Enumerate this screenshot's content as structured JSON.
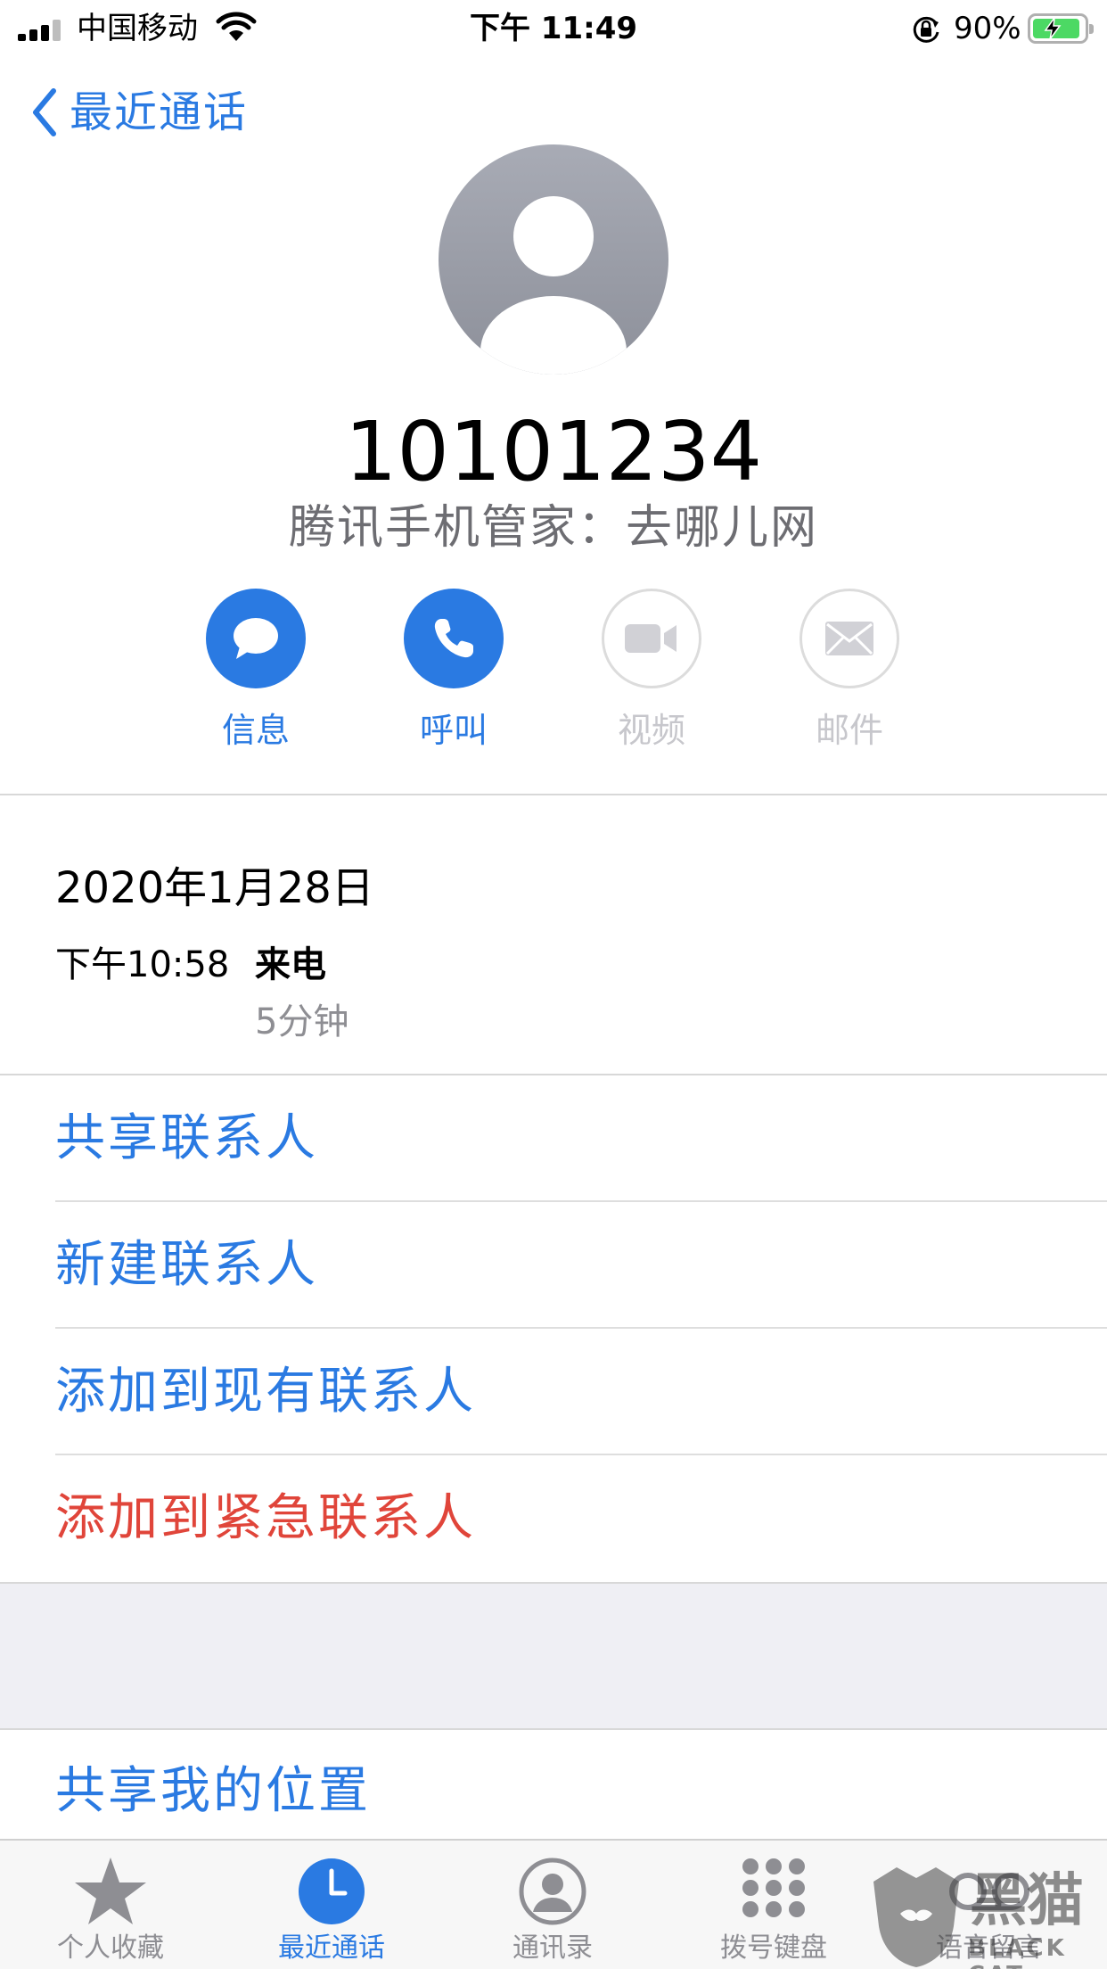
{
  "status_bar": {
    "carrier": "中国移动",
    "time": "下午 11:49",
    "battery_percent": "90%",
    "battery_level": 0.9,
    "icons": [
      "signal-icon",
      "wifi-icon",
      "rotation-lock-icon",
      "battery-charging-icon"
    ]
  },
  "nav": {
    "back_label": "最近通话"
  },
  "contact": {
    "number": "10101234",
    "subtitle": "腾讯手机管家：去哪儿网"
  },
  "actions": [
    {
      "label": "信息",
      "icon": "message-icon",
      "enabled": true
    },
    {
      "label": "呼叫",
      "icon": "phone-icon",
      "enabled": true
    },
    {
      "label": "视频",
      "icon": "video-icon",
      "enabled": false
    },
    {
      "label": "邮件",
      "icon": "mail-icon",
      "enabled": false
    }
  ],
  "call_log": {
    "date": "2020年1月28日",
    "time": "下午10:58",
    "type": "来电",
    "duration": "5分钟"
  },
  "menu": [
    {
      "label": "共享联系人"
    },
    {
      "label": "新建联系人"
    },
    {
      "label": "添加到现有联系人"
    },
    {
      "label": "添加到紧急联系人"
    }
  ],
  "location_row": {
    "label": "共享我的位置"
  },
  "tabs": [
    {
      "label": "个人收藏",
      "icon": "star-icon",
      "active": false
    },
    {
      "label": "最近通话",
      "icon": "clock-icon",
      "active": true
    },
    {
      "label": "通讯录",
      "icon": "contacts-icon",
      "active": false
    },
    {
      "label": "拨号键盘",
      "icon": "keypad-icon",
      "active": false
    },
    {
      "label": "语音留言",
      "icon": "voicemail-icon",
      "active": false
    }
  ],
  "watermark": {
    "text": "黑猫",
    "subtext": "BLACK CAT"
  },
  "colors": {
    "accent": "#2a7ae2",
    "destructive": "#e0453a",
    "secondary_text": "#8e8e93"
  }
}
